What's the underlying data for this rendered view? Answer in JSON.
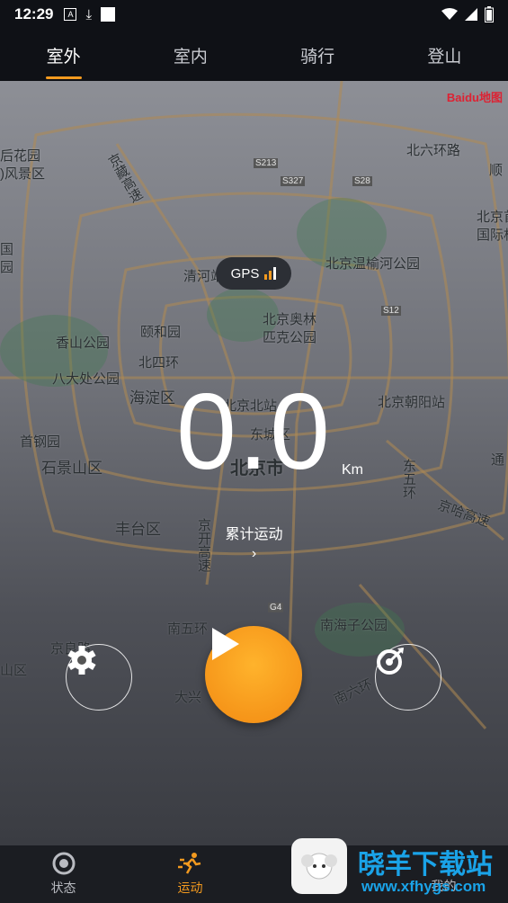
{
  "status_bar": {
    "time": "12:29"
  },
  "tabs": [
    {
      "label": "室外",
      "active": true
    },
    {
      "label": "室内",
      "active": false
    },
    {
      "label": "骑行",
      "active": false
    },
    {
      "label": "登山",
      "active": false
    }
  ],
  "map": {
    "provider": "Baidu地图",
    "labels": [
      "后花园",
      ")风景区",
      "北六环路",
      "顺",
      "京藏高速",
      "北京首",
      "国际机",
      "清河站",
      "北京温榆河公园",
      "国",
      "园",
      "北京奥林",
      "匹克公园",
      "香山公园",
      "颐和园",
      "北四环",
      "八大处公园",
      "海淀区",
      "北京北站",
      "北京朝阳站",
      "首钢园",
      "石景山区",
      "东城区",
      "北京市",
      "东五环",
      "通",
      "丰台区",
      "京开高速",
      "京哈高速",
      "南五环",
      "南海子公园",
      "京良路",
      "山区",
      "大兴",
      "南六环",
      "S213",
      "S327",
      "S28",
      "S12",
      "G4"
    ]
  },
  "gps": {
    "label": "GPS"
  },
  "distance": {
    "value": "0.0",
    "unit": "Km"
  },
  "cumulative": {
    "label": "累计运动",
    "arrow": "›"
  },
  "controls": {
    "settings_icon": "gear-icon",
    "play_icon": "play-icon",
    "right_icon": "target-icon"
  },
  "bottom_nav": [
    {
      "label": "状态",
      "icon": "status-icon",
      "active": false
    },
    {
      "label": "运动",
      "icon": "running-icon",
      "active": true
    },
    {
      "label": "",
      "icon": "",
      "active": false
    },
    {
      "label": "我的",
      "icon": "profile-icon",
      "active": false
    }
  ],
  "watermark": {
    "title": "晓羊下载站",
    "url": "www.xfhygs.com"
  },
  "colors": {
    "accent": "#f39a1f",
    "play_gradient_start": "#ffb32c",
    "play_gradient_end": "#f28a12",
    "watermark": "#1aa3e8"
  }
}
